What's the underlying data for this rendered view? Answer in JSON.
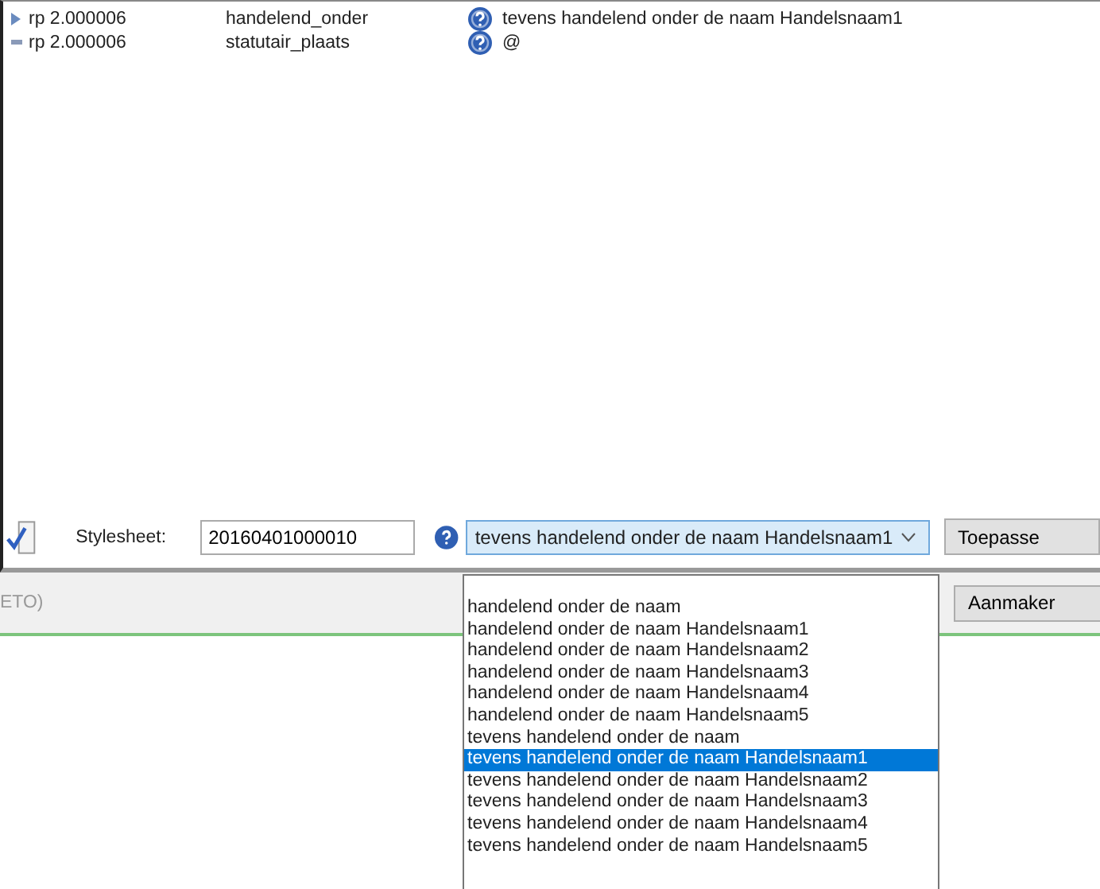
{
  "rows": [
    {
      "kind": "arrow",
      "id": "rp 2.000006",
      "name": "handelend_onder",
      "value": "tevens handelend onder de naam Handelsnaam1"
    },
    {
      "kind": "dash",
      "id": "rp 2.000006",
      "name": "statutair_plaats",
      "value": "@"
    }
  ],
  "toolbar": {
    "label": "Stylesheet:",
    "stylesheet_value": "20160401000010",
    "combo_value": "tevens handelend onder de naam Handelsnaam1",
    "apply_button": "Toepasse"
  },
  "lower": {
    "fragment": "ETO)",
    "create_button": "Aanmaker"
  },
  "dropdown": [
    {
      "label": "handelend onder de naam",
      "selected": false
    },
    {
      "label": "handelend onder de naam Handelsnaam1",
      "selected": false
    },
    {
      "label": "handelend onder de naam Handelsnaam2",
      "selected": false
    },
    {
      "label": "handelend onder de naam Handelsnaam3",
      "selected": false
    },
    {
      "label": "handelend onder de naam Handelsnaam4",
      "selected": false
    },
    {
      "label": "handelend onder de naam Handelsnaam5",
      "selected": false
    },
    {
      "label": "tevens handelend onder de naam",
      "selected": false
    },
    {
      "label": "tevens handelend onder de naam Handelsnaam1",
      "selected": true
    },
    {
      "label": "tevens handelend onder de naam Handelsnaam2",
      "selected": false
    },
    {
      "label": "tevens handelend onder de naam Handelsnaam3",
      "selected": false
    },
    {
      "label": "tevens handelend onder de naam Handelsnaam4",
      "selected": false
    },
    {
      "label": "tevens handelend onder de naam Handelsnaam5",
      "selected": false
    }
  ]
}
